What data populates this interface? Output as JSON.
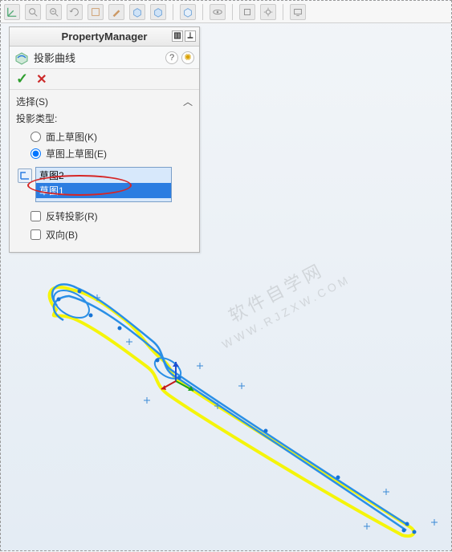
{
  "toolbar": {
    "icons": [
      "axis-icon",
      "zoom-in-icon",
      "zoom-out-icon",
      "rotate-icon",
      "sketch-icon",
      "pencil-icon",
      "box-icon",
      "box2-icon",
      "sep",
      "feature-icon",
      "sep",
      "eye-icon",
      "sep",
      "tool-icon",
      "settings-icon",
      "sep",
      "screen-icon"
    ]
  },
  "pm": {
    "header": "PropertyManager",
    "feature_name": "投影曲线",
    "ok_tip": "OK",
    "cancel_tip": "Cancel"
  },
  "section": {
    "title": "选择(S)",
    "projection_type_label": "投影类型:",
    "radio_face": "面上草图(K)",
    "radio_sketch": "草图上草图(E)",
    "list_items": [
      "草图2",
      "草图1"
    ],
    "selected_index": 1,
    "check_reverse": "反转投影(R)",
    "check_bidir": "双向(B)"
  },
  "watermark": {
    "line1": "软件自学网",
    "line2": "WWW.RJZXW.COM"
  }
}
